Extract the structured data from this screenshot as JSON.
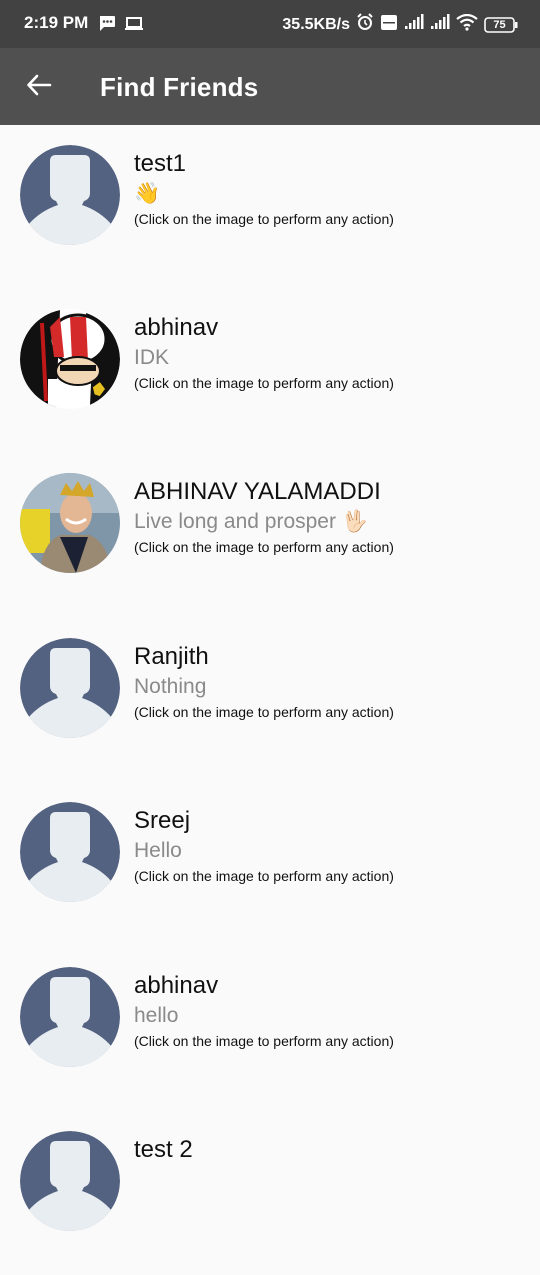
{
  "status_bar": {
    "time": "2:19 PM",
    "network_speed": "35.5KB/s",
    "battery": "75",
    "icons": [
      "message-icon",
      "laptop-icon",
      "alarm-icon",
      "volte-icon",
      "signal-icon",
      "signal-icon",
      "wifi-icon",
      "battery-icon"
    ]
  },
  "app_bar": {
    "title": "Find Friends",
    "back_icon": "arrow-left-icon"
  },
  "hint_text": "(Click on the image to perform any action)",
  "friends": [
    {
      "name": "test1",
      "status": "👋",
      "avatar": "default-profile-icon"
    },
    {
      "name": "abhinav",
      "status": "IDK",
      "avatar": "cartoon-profile-image"
    },
    {
      "name": "ABHINAV YALAMADDI",
      "status": "Live long and prosper 🖖🏻",
      "avatar": "photo-profile-image"
    },
    {
      "name": "Ranjith",
      "status": "Nothing",
      "avatar": "default-profile-icon"
    },
    {
      "name": "Sreej",
      "status": "Hello",
      "avatar": "default-profile-icon"
    },
    {
      "name": "abhinav",
      "status": "hello",
      "avatar": "default-profile-icon"
    },
    {
      "name": "test 2",
      "status": "",
      "avatar": "default-profile-icon"
    }
  ],
  "colors": {
    "status_bar": "#424242",
    "app_bar": "#505050",
    "background": "#fafafa",
    "avatar_bg": "#546281",
    "avatar_silhouette": "#e8edf1"
  }
}
